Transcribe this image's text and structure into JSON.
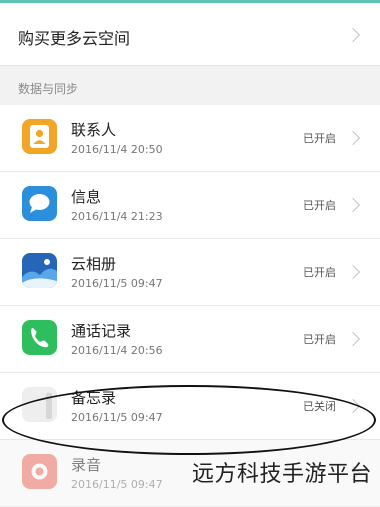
{
  "buy": {
    "label": "购买更多云空间"
  },
  "section": {
    "title": "数据与同步"
  },
  "items": [
    {
      "name": "联系人",
      "time": "2016/11/4 20:50",
      "status": "已开启",
      "icon": "contacts-icon",
      "color": "#f2a526"
    },
    {
      "name": "信息",
      "time": "2016/11/4 21:23",
      "status": "已开启",
      "icon": "messages-icon",
      "color": "#2b8fdb"
    },
    {
      "name": "云相册",
      "time": "2016/11/5 09:47",
      "status": "已开启",
      "icon": "gallery-icon",
      "color": "#2566b8"
    },
    {
      "name": "通话记录",
      "time": "2016/11/4 20:56",
      "status": "已开启",
      "icon": "phone-icon",
      "color": "#2fbe5e"
    },
    {
      "name": "备忘录",
      "time": "2016/11/5 09:47",
      "status": "已关闭",
      "icon": "notepad-icon",
      "color": "#e8e8e8"
    },
    {
      "name": "录音",
      "time": "2016/11/5 09:47",
      "status": "",
      "icon": "recorder-icon",
      "color": "#ef7466"
    }
  ],
  "watermark": {
    "text": "远方科技手游平台"
  }
}
